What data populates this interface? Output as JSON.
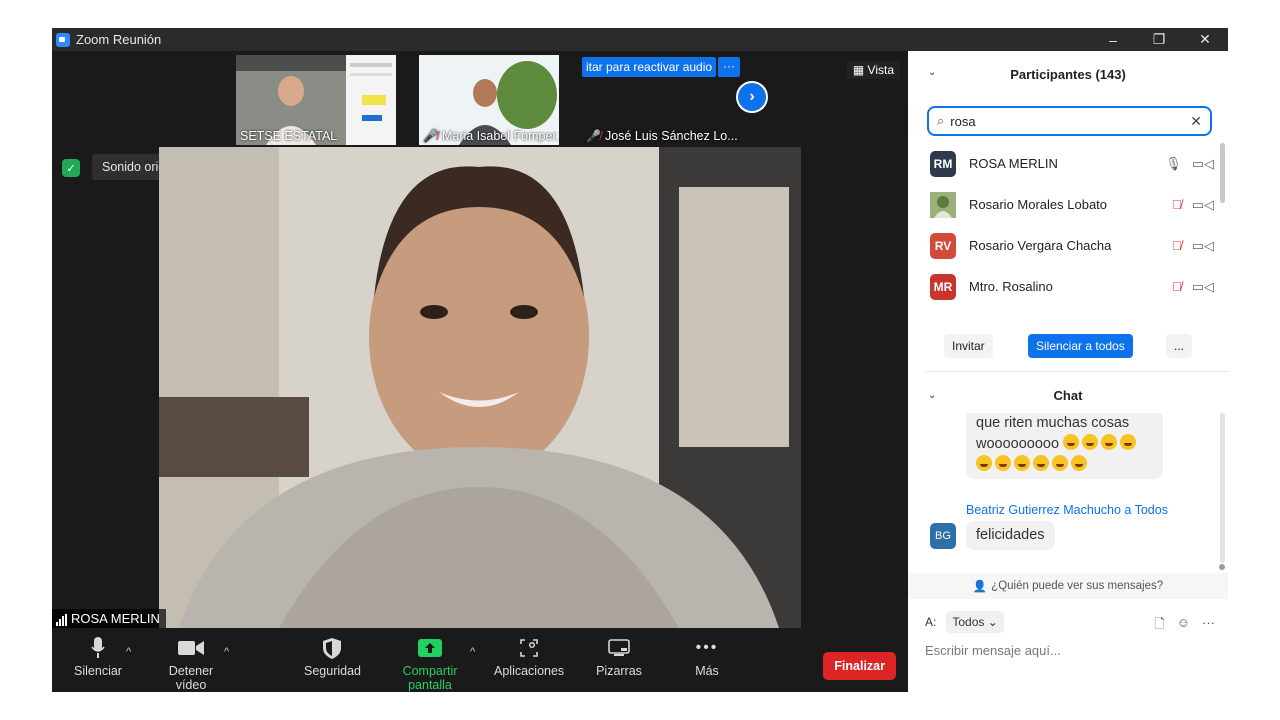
{
  "window": {
    "title": "Zoom Reunión",
    "controls": [
      "–",
      "❐",
      "✕"
    ]
  },
  "thumbnails": [
    {
      "name": "SETSE ESTATAL",
      "muted": false
    },
    {
      "name": "Maria Isabel Fomper...",
      "muted": true
    },
    {
      "name": "José Luis Sánchez Lo...",
      "muted": true,
      "banner": "itar para reactivar audio",
      "banner_more": "···"
    }
  ],
  "vista_label": "Vista",
  "audio_status": "Sonido original: desactivado",
  "active_speaker": "ROSA MERLIN",
  "toolbar": {
    "mute": "Silenciar",
    "video": "Detener vídeo",
    "security": "Seguridad",
    "share": "Compartir pantalla",
    "apps": "Aplicaciones",
    "whiteboards": "Pizarras",
    "more": "Más",
    "end": "Finalizar"
  },
  "participants": {
    "header": "Participantes (143)",
    "search_value": "rosa",
    "items": [
      {
        "initials": "RM",
        "name": "ROSA MERLIN",
        "color": "#2f3b4a",
        "muted": false
      },
      {
        "initials": "",
        "name": "Rosario Morales Lobato",
        "color": "#6b8f4e",
        "muted": true
      },
      {
        "initials": "RV",
        "name": "Rosario Vergara Chacha",
        "color": "#d24a3a",
        "muted": true
      },
      {
        "initials": "MR",
        "name": "Mtro. Rosalino",
        "color": "#c9352b",
        "muted": true
      }
    ],
    "invite": "Invitar",
    "mute_all": "Silenciar a todos",
    "more": "..."
  },
  "chat": {
    "header": "Chat",
    "messages": [
      {
        "text_line1": "que riten muchas cosas",
        "text_line2": "wooooooooo"
      },
      {
        "sender": "Beatriz Gutierrez Machucho a Todos",
        "initials": "BG",
        "text": "felicidades"
      }
    ],
    "who_can_see": "¿Quién puede ver sus mensajes?",
    "to_label": "A:",
    "to_value": "Todos",
    "placeholder": "Escribir mensaje aquí..."
  },
  "colors": {
    "accent": "#0e72ed",
    "end": "#dc2626",
    "share": "#23d160",
    "muted": "#e0393e"
  }
}
